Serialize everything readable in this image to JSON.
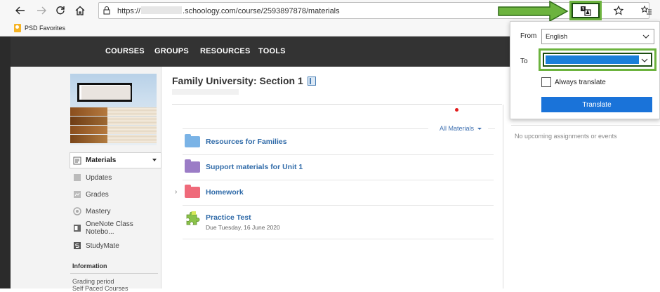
{
  "browser": {
    "url_prefix": "https://",
    "url_domain": ".schoology.com/course/2593897878/materials",
    "favorites": [
      {
        "label": "PSD Favorites"
      }
    ]
  },
  "header": {
    "nav": [
      "COURSES",
      "GROUPS",
      "RESOURCES",
      "TOOLS"
    ]
  },
  "sidebar": {
    "menu": [
      {
        "label": "Materials",
        "icon": "materials-icon",
        "active": true
      },
      {
        "label": "Updates",
        "icon": "updates-icon"
      },
      {
        "label": "Grades",
        "icon": "grades-icon"
      },
      {
        "label": "Mastery",
        "icon": "mastery-icon"
      },
      {
        "label": "OneNote Class Notebo...",
        "icon": "onenote-icon"
      },
      {
        "label": "StudyMate",
        "icon": "studymate-icon"
      }
    ],
    "info_title": "Information",
    "info_lines": [
      "Grading period",
      "Self Paced Courses"
    ]
  },
  "main": {
    "course_title": "Family University: Section 1",
    "filter_label": "All Materials",
    "materials": [
      {
        "label": "Resources for Families",
        "type": "folder",
        "color": "#7ab3e6"
      },
      {
        "label": "Support materials for Unit 1",
        "type": "folder",
        "color": "#9b7cc6"
      },
      {
        "label": "Homework",
        "type": "folder",
        "color": "#ef6a7a"
      },
      {
        "label": "Practice Test",
        "type": "assessment",
        "due": "Due Tuesday, 16 June 2020"
      }
    ]
  },
  "right_panel": {
    "upcoming_text": "No upcoming assignments or events"
  },
  "translate_popup": {
    "from_label": "From",
    "from_value": "English",
    "to_label": "To",
    "always_translate_label": "Always translate",
    "translate_button": "Translate"
  },
  "colors": {
    "header_bg": "#333333",
    "link": "#2f6aa8",
    "highlight_green": "#6cb33e",
    "translate_blue": "#1a73d9"
  }
}
